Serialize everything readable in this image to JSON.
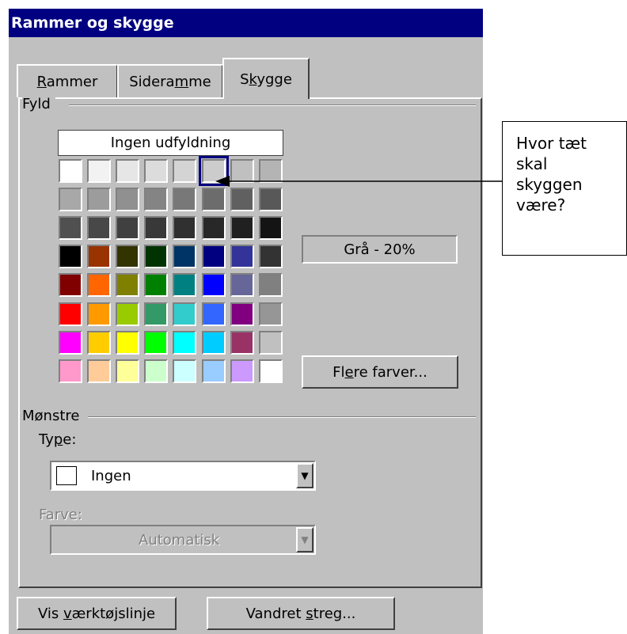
{
  "dialog": {
    "title": "Rammer og skygge",
    "tabs": [
      {
        "pre": "",
        "u": "R",
        "post": "ammer"
      },
      {
        "pre": "Sidera",
        "u": "m",
        "post": "me"
      },
      {
        "pre": "S",
        "u": "k",
        "post": "ygge"
      }
    ],
    "fill": {
      "group_label": "Fyld",
      "no_fill_label": "Ingen udfyldning",
      "selected_name": "Grå - 20%",
      "more_colors": {
        "pre": "Fl",
        "u": "e",
        "post": "re farver..."
      },
      "palette": [
        [
          "#ffffff",
          "#f2f2f2",
          "#e6e6e6",
          "#dcdcdc",
          "#d4d4d4",
          "#cccccc",
          "#c0c0c0",
          "#b4b4b4"
        ],
        [
          "#a8a8a8",
          "#9c9c9c",
          "#909090",
          "#848484",
          "#787878",
          "#6c6c6c",
          "#606060",
          "#585858"
        ],
        [
          "#505050",
          "#484848",
          "#404040",
          "#383838",
          "#303030",
          "#282828",
          "#202020",
          "#141414"
        ],
        [
          "#000000",
          "#993300",
          "#333300",
          "#003300",
          "#003366",
          "#000080",
          "#333399",
          "#333333"
        ],
        [
          "#800000",
          "#ff6600",
          "#808000",
          "#008000",
          "#008080",
          "#0000ff",
          "#666699",
          "#808080"
        ],
        [
          "#ff0000",
          "#ff9900",
          "#99cc00",
          "#339966",
          "#33cccc",
          "#3366ff",
          "#800080",
          "#969696"
        ],
        [
          "#ff00ff",
          "#ffcc00",
          "#ffff00",
          "#00ff00",
          "#00ffff",
          "#00ccff",
          "#993366",
          "#c0c0c0"
        ],
        [
          "#ff99cc",
          "#ffcc99",
          "#ffff99",
          "#ccffcc",
          "#ccffff",
          "#99ccff",
          "#cc99ff",
          "#ffffff"
        ]
      ],
      "selected_row": 0,
      "selected_col": 5
    },
    "patterns": {
      "group_label": "Mønstre",
      "type_label": {
        "pre": "Ty",
        "u": "p",
        "post": "e:"
      },
      "type_value": "Ingen",
      "color_label": "Farve:",
      "color_value": "Automatisk"
    },
    "bottom": {
      "toolbar_button": {
        "pre": "Vis ",
        "u": "v",
        "post": "ærktøjslinje"
      },
      "hline_button": {
        "pre": "Vandret ",
        "u": "s",
        "post": "treg..."
      }
    }
  },
  "callout": {
    "lines": [
      "Hvor tæt",
      "skal",
      "skyggen",
      "være?"
    ]
  }
}
